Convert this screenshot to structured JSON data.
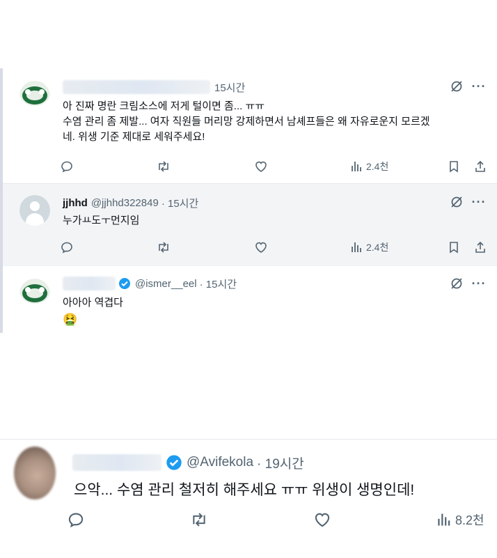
{
  "tweets": [
    {
      "author_handle_time": "15시간",
      "text_line1": "아 진짜 명란 크림소스에 저게 털이면 좀... ㅠㅠ",
      "text_line2": "수염 관리 좀 제발... 여자 직원들 머리망 강제하면서 남셰프들은 왜 자유로운지 모르겠",
      "text_line3": "네. 위생 기준 제대로 세워주세요!",
      "views": "2.4천"
    },
    {
      "name": "jjhhd",
      "handle": "@jjhhd322849",
      "time": "· 15시간",
      "text": "누가ㅛ도ㅜ먼지임",
      "views": "2.4천"
    },
    {
      "handle": "@ismer__eel",
      "time": "· 15시간",
      "text": "아아아 역겹다",
      "emoji": "🤮"
    }
  ],
  "bottom_tweet": {
    "handle": "@Avifekola",
    "time": "· 19시간",
    "text": "으악... 수염 관리 철저히 해주세요 ㅠㅠ 위생이 생명인데!",
    "views": "8.2천"
  },
  "icons": {
    "reply": "reply-icon",
    "retweet": "retweet-icon",
    "like": "like-icon",
    "views": "views-icon",
    "bookmark": "bookmark-icon",
    "share": "share-icon",
    "grok": "grok-icon",
    "more": "more-icon",
    "verified": "verified-badge-icon"
  },
  "colors": {
    "text": "#0f1419",
    "muted": "#536471",
    "verified": "#1d9bf0",
    "avatar_green": "#1f6f3c"
  }
}
